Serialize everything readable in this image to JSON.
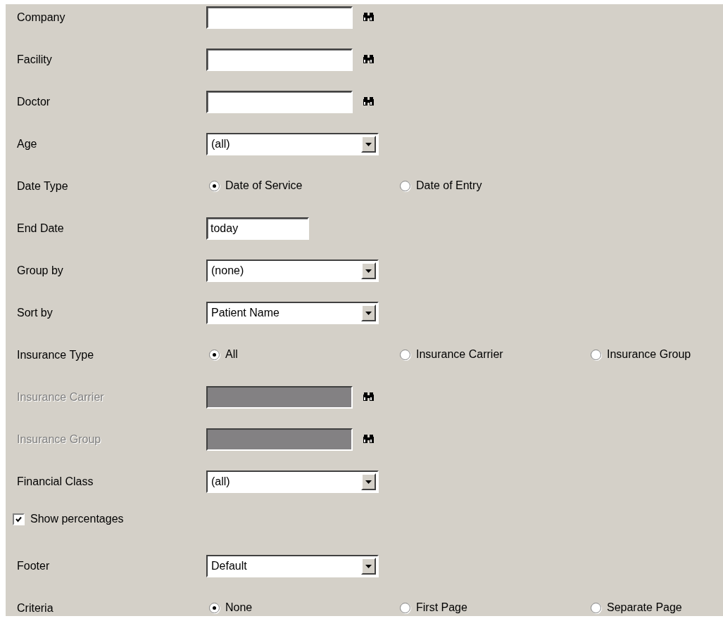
{
  "rows": [
    {
      "kind": "lookup",
      "label": "Company",
      "value": "",
      "disabled": false
    },
    {
      "kind": "lookup",
      "label": "Facility",
      "value": "",
      "disabled": false
    },
    {
      "kind": "lookup",
      "label": "Doctor",
      "value": "",
      "disabled": false
    },
    {
      "kind": "select",
      "label": "Age",
      "value": "(all)"
    },
    {
      "kind": "radio",
      "label": "Date Type",
      "options": [
        {
          "label": "Date of Service",
          "selected": true
        },
        {
          "label": "Date of Entry",
          "selected": false
        }
      ]
    },
    {
      "kind": "date",
      "label": "End Date",
      "value": "today"
    },
    {
      "kind": "select",
      "label": "Group by",
      "value": "(none)"
    },
    {
      "kind": "select",
      "label": "Sort by",
      "value": "Patient Name"
    },
    {
      "kind": "radio",
      "label": "Insurance Type",
      "options": [
        {
          "label": "All",
          "selected": true
        },
        {
          "label": "Insurance Carrier",
          "selected": false
        },
        {
          "label": "Insurance Group",
          "selected": false
        }
      ]
    },
    {
      "kind": "lookup",
      "label": "Insurance Carrier",
      "value": "",
      "disabled": true
    },
    {
      "kind": "lookup",
      "label": "Insurance Group",
      "value": "",
      "disabled": true
    },
    {
      "kind": "select",
      "label": "Financial Class",
      "value": "(all)"
    },
    {
      "kind": "checkbox",
      "label": "Show percentages",
      "checked": true
    },
    {
      "kind": "select",
      "label": "Footer",
      "value": "Default"
    },
    {
      "kind": "radio",
      "label": "Criteria",
      "options": [
        {
          "label": "None",
          "selected": true
        },
        {
          "label": "First Page",
          "selected": false
        },
        {
          "label": "Separate Page",
          "selected": false
        }
      ]
    }
  ]
}
